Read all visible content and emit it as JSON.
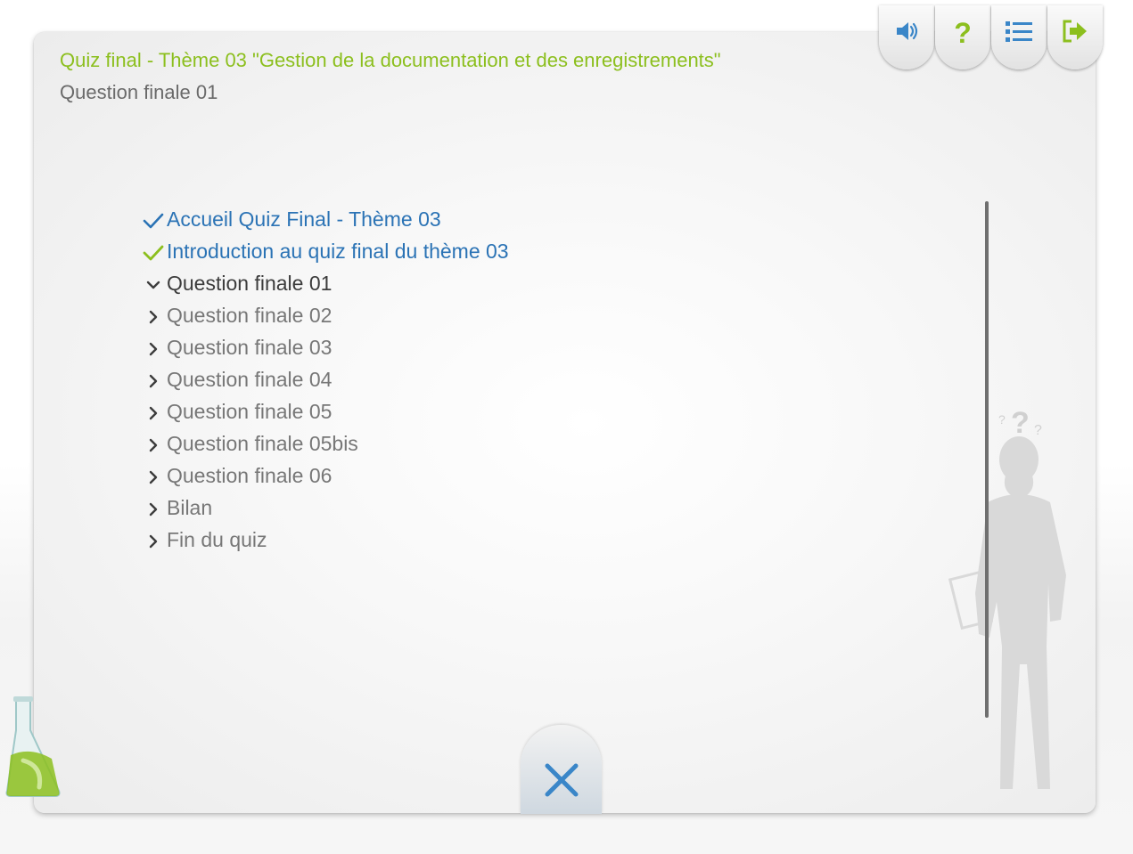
{
  "header": {
    "title": "Quiz final - Thème 03 \"Gestion de la documentation et des enregistrements\"",
    "subtitle": "Question finale 01"
  },
  "toolbar": {
    "buttons": [
      {
        "icon": "speaker-icon",
        "color": "#3a86c8"
      },
      {
        "icon": "help-icon",
        "color": "#8cbf1e"
      },
      {
        "icon": "list-icon",
        "color": "#3a86c8"
      },
      {
        "icon": "exit-icon",
        "color": "#8cbf1e"
      }
    ]
  },
  "toc": {
    "items": [
      {
        "label": "Accueil Quiz Final - Thème 03",
        "state": "visited",
        "marker": "check-icon",
        "marker_color": "#2b73b5"
      },
      {
        "label": "Introduction au quiz final du thème 03",
        "state": "visited",
        "marker": "check-icon",
        "marker_color": "#8cbf1e"
      },
      {
        "label": "Question finale 01",
        "state": "current",
        "marker": "chevron-down-icon",
        "marker_color": "#3c3c3c"
      },
      {
        "label": "Question finale 02",
        "state": "pending",
        "marker": "chevron-right-icon",
        "marker_color": "#3c3c3c"
      },
      {
        "label": "Question finale 03",
        "state": "pending",
        "marker": "chevron-right-icon",
        "marker_color": "#3c3c3c"
      },
      {
        "label": "Question finale 04",
        "state": "pending",
        "marker": "chevron-right-icon",
        "marker_color": "#3c3c3c"
      },
      {
        "label": "Question finale 05",
        "state": "pending",
        "marker": "chevron-right-icon",
        "marker_color": "#3c3c3c"
      },
      {
        "label": "Question finale 05bis",
        "state": "pending",
        "marker": "chevron-right-icon",
        "marker_color": "#3c3c3c"
      },
      {
        "label": "Question finale 06",
        "state": "pending",
        "marker": "chevron-right-icon",
        "marker_color": "#3c3c3c"
      },
      {
        "label": "Bilan",
        "state": "pending",
        "marker": "chevron-right-icon",
        "marker_color": "#3c3c3c"
      },
      {
        "label": "Fin du quiz",
        "state": "pending",
        "marker": "chevron-right-icon",
        "marker_color": "#3c3c3c"
      }
    ]
  },
  "close_button": {
    "icon": "close-icon",
    "color": "#3a86c8"
  },
  "decor": {
    "flask_icon": "flask-icon",
    "figure_icon": "thinking-woman-silhouette-icon",
    "accent_green": "#8cbf1e",
    "accent_blue": "#2b73b5"
  }
}
